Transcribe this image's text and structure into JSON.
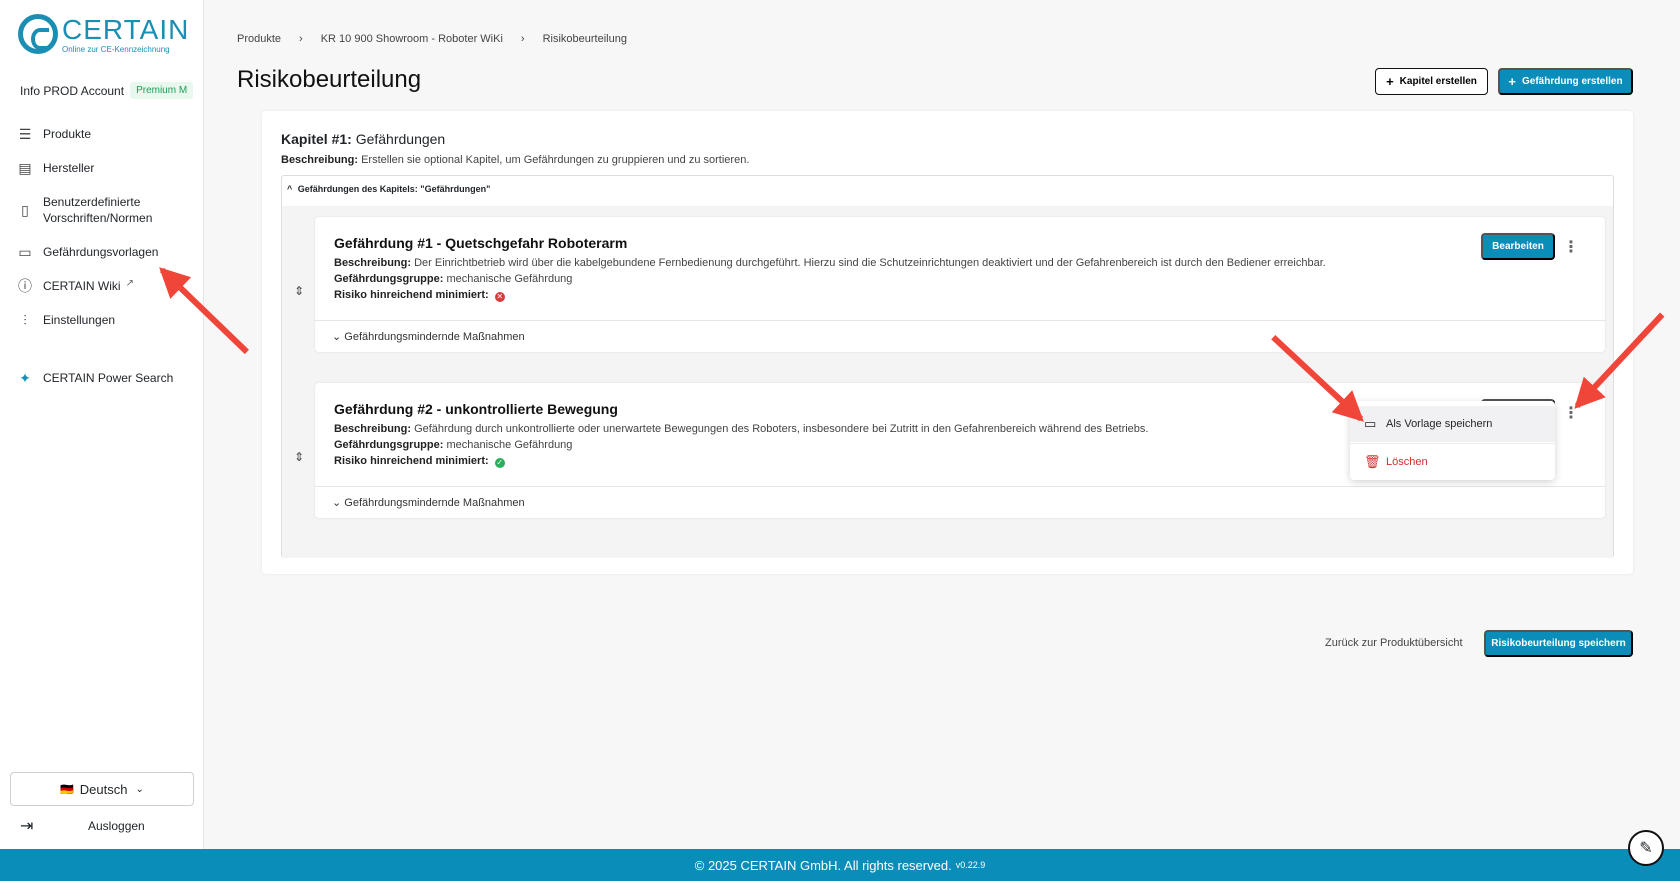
{
  "brand": {
    "name": "CERTAIN",
    "tagline": "Online zur CE-Kennzeichnung"
  },
  "account": {
    "name": "Info PROD Account",
    "plan": "Premium M"
  },
  "nav": [
    {
      "id": "produkte",
      "label": "Produkte",
      "icon": "list-icon"
    },
    {
      "id": "hersteller",
      "label": "Hersteller",
      "icon": "store-icon"
    },
    {
      "id": "vorschriften",
      "label": "Benutzerdefinierte Vorschriften/Normen",
      "icon": "document-chart-icon"
    },
    {
      "id": "vorlagen",
      "label": "Gefährdungsvorlagen",
      "icon": "book-icon"
    },
    {
      "id": "wiki",
      "label": "CERTAIN Wiki",
      "icon": "info-icon"
    },
    {
      "id": "einstellungen",
      "label": "Einstellungen",
      "icon": "sliders-icon"
    },
    {
      "id": "powersearch",
      "label": "CERTAIN Power Search",
      "icon": "sparkle-icon"
    }
  ],
  "language": {
    "selected": "Deutsch",
    "flag": "🇩🇪"
  },
  "logout": "Ausloggen",
  "breadcrumb": [
    "Produkte",
    "KR 10 900 Showroom - Roboter WiKi",
    "Risikobeurteilung"
  ],
  "page": {
    "title": "Risikobeurteilung",
    "create_chapter": "Kapitel erstellen",
    "create_hazard": "Gefährdung erstellen"
  },
  "chapter": {
    "prefix": "Kapitel #1:",
    "name": "Gefährdungen",
    "desc_label": "Beschreibung:",
    "desc": "Erstellen sie optional Kapitel, um Gefährdungen zu gruppieren und zu sortieren.",
    "group_header": "Gefährdungen des Kapitels: \"Gefährdungen\""
  },
  "hazards": [
    {
      "title": "Gefährdung #1 - Quetschgefahr Roboterarm",
      "desc_label": "Beschreibung:",
      "desc": "Der Einrichtbetrieb wird über die kabelgebundene Fernbedienung durchgeführt. Hierzu sind die Schutzeinrichtungen deaktiviert und der Gefahrenbereich ist durch den Bediener erreichbar.",
      "group_label": "Gefährdungsgruppe:",
      "group": "mechanische Gefährdung",
      "risk_label": "Risiko hinreichend minimiert:",
      "risk_minimized": false,
      "measures": "Gefährdungsmindernde Maßnahmen",
      "edit": "Bearbeiten"
    },
    {
      "title": "Gefährdung #2 - unkontrollierte Bewegung",
      "desc_label": "Beschreibung:",
      "desc": "Gefährdung durch unkontrollierte oder unerwartete Bewegungen des Roboters, insbesondere bei Zutritt in den Gefahrenbereich während des Betriebs.",
      "group_label": "Gefährdungsgruppe:",
      "group": "mechanische Gefährdung",
      "risk_label": "Risiko hinreichend minimiert:",
      "risk_minimized": true,
      "measures": "Gefährdungsmindernde Maßnahmen"
    }
  ],
  "context_menu": {
    "save_template": "Als Vorlage speichern",
    "delete": "Löschen"
  },
  "actions": {
    "back": "Zurück zur Produktübersicht",
    "save": "Risikobeurteilung speichern"
  },
  "footer": {
    "text": "© 2025 CERTAIN GmbH. All rights reserved.",
    "version": "v0.22.9"
  },
  "colors": {
    "primary": "#0b8dba",
    "danger": "#d93a3a",
    "success": "#28b05a",
    "annotation": "#f0463a"
  }
}
